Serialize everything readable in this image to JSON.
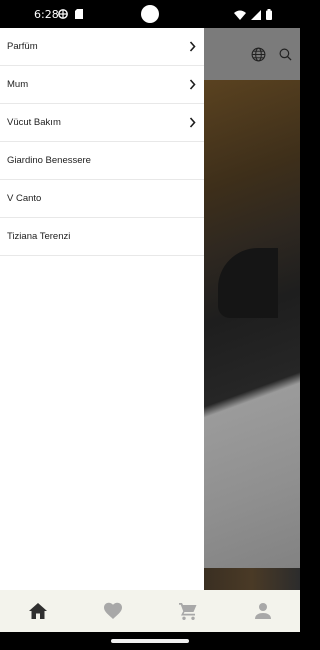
{
  "status_bar": {
    "time": "6:28"
  },
  "drawer": {
    "items": [
      {
        "label": "Parfüm",
        "has_children": true
      },
      {
        "label": "Mum",
        "has_children": true
      },
      {
        "label": "Vücut Bakım",
        "has_children": true
      },
      {
        "label": "Giardino Benessere",
        "has_children": false
      },
      {
        "label": "V Canto",
        "has_children": false
      },
      {
        "label": "Tiziana Terenzi",
        "has_children": false
      }
    ]
  },
  "header": {
    "icons": [
      "globe-icon",
      "search-icon"
    ]
  },
  "bottom_nav": {
    "items": [
      {
        "icon": "home-icon",
        "active": true
      },
      {
        "icon": "heart-icon",
        "active": false
      },
      {
        "icon": "cart-icon",
        "active": false
      },
      {
        "icon": "profile-icon",
        "active": false
      }
    ],
    "active_color": "#2f2f2f",
    "inactive_color": "#a8a8a8"
  }
}
